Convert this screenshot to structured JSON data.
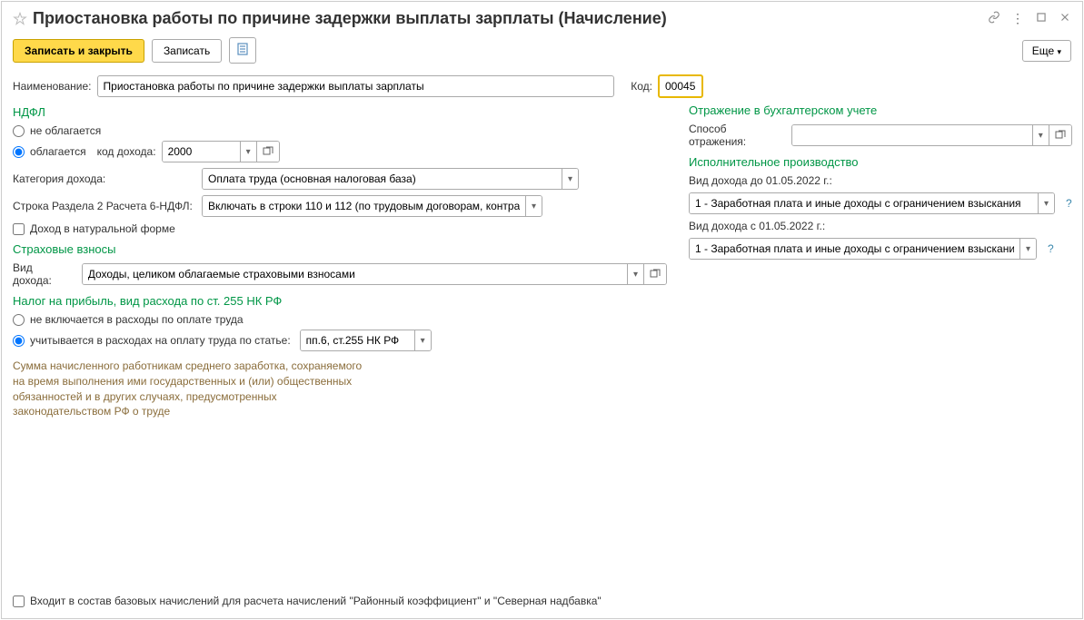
{
  "window": {
    "title": "Приостановка работы по причине задержки выплаты зарплаты (Начисление)"
  },
  "toolbar": {
    "save_close": "Записать и закрыть",
    "save": "Записать",
    "more": "Еще"
  },
  "form": {
    "name_label": "Наименование:",
    "name_value": "Приостановка работы по причине задержки выплаты зарплаты",
    "code_label": "Код:",
    "code_value": "00045"
  },
  "ndfl": {
    "title": "НДФЛ",
    "not_taxed": "не облагается",
    "taxed": "облагается",
    "income_code_label": "код дохода:",
    "income_code_value": "2000",
    "category_label": "Категория дохода:",
    "category_value": "Оплата труда (основная налоговая база)",
    "line2_label": "Строка Раздела 2 Расчета 6-НДФЛ:",
    "line2_value": "Включать в строки 110 и 112 (по трудовым договорам, контракт",
    "natural_income": "Доход в натуральной форме"
  },
  "insurance": {
    "title": "Страховые взносы",
    "income_type_label": "Вид дохода:",
    "income_type_value": "Доходы, целиком облагаемые страховыми взносами"
  },
  "profit_tax": {
    "title": "Налог на прибыль, вид расхода по ст. 255 НК РФ",
    "not_included": "не включается в расходы по оплате труда",
    "included": "учитывается в расходах на оплату труда по статье:",
    "article_value": "пп.6, ст.255 НК РФ",
    "note": "Сумма начисленного работникам среднего заработка, сохраняемого на время выполнения ими государственных и (или) общественных обязанностей и в других случаях, предусмотренных законодательством РФ о труде"
  },
  "accounting": {
    "title": "Отражение в бухгалтерском учете",
    "method_label": "Способ отражения:",
    "method_value": ""
  },
  "enforcement": {
    "title": "Исполнительное производство",
    "before_label": "Вид дохода до 01.05.2022 г.:",
    "before_value": "1 - Заработная плата и иные доходы с ограничением взыскания",
    "after_label": "Вид дохода с 01.05.2022 г.:",
    "after_value": "1 - Заработная плата и иные доходы с ограничением взыскани"
  },
  "footer": {
    "base_calc": "Входит в состав базовых начислений для расчета начислений \"Районный коэффициент\" и \"Северная надбавка\""
  }
}
